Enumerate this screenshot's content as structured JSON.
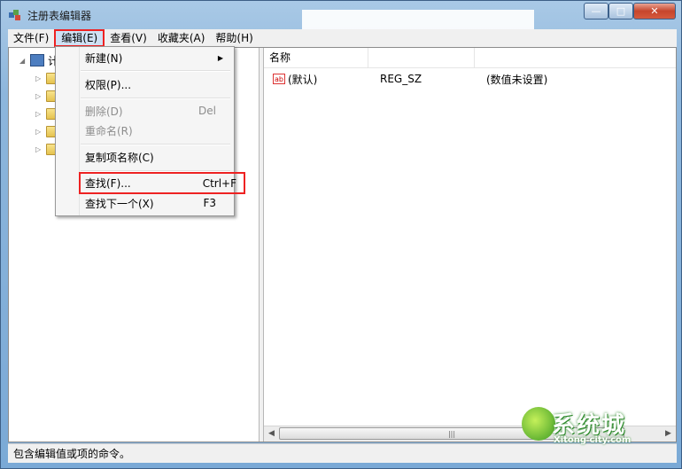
{
  "window": {
    "title": "注册表编辑器",
    "controls": {
      "minimize": "—",
      "maximize": "□",
      "close": "✕"
    }
  },
  "menubar": {
    "items": [
      "文件(F)",
      "编辑(E)",
      "查看(V)",
      "收藏夹(A)",
      "帮助(H)"
    ],
    "active_index": 1
  },
  "tree": {
    "root_label": "计",
    "child_count": 5
  },
  "list": {
    "columns": {
      "name": "名称",
      "type": "",
      "data": ""
    },
    "rows": [
      {
        "name": "(默认)",
        "type": "REG_SZ",
        "data": "(数值未设置)",
        "icon": "ab-string-icon"
      }
    ]
  },
  "edit_menu": {
    "new": {
      "label": "新建(N)",
      "arrow": "▶"
    },
    "permissions": {
      "label": "权限(P)..."
    },
    "delete": {
      "label": "删除(D)",
      "accel": "Del"
    },
    "rename": {
      "label": "重命名(R)"
    },
    "copy_key_name": {
      "label": "复制项名称(C)"
    },
    "find": {
      "label": "查找(F)...",
      "accel": "Ctrl+F"
    },
    "find_next": {
      "label": "查找下一个(X)",
      "accel": "F3"
    }
  },
  "status": {
    "text": "包含编辑值或项的命令。"
  },
  "scrollbar": {
    "left": "◀",
    "grip": "|||",
    "right": "▶"
  },
  "watermark": {
    "text": "系统城",
    "sub": "Xitong city.com"
  },
  "colors": {
    "frame": "#7aa9d6",
    "highlight_border": "#ee2222",
    "close_button": "#c6452c"
  }
}
